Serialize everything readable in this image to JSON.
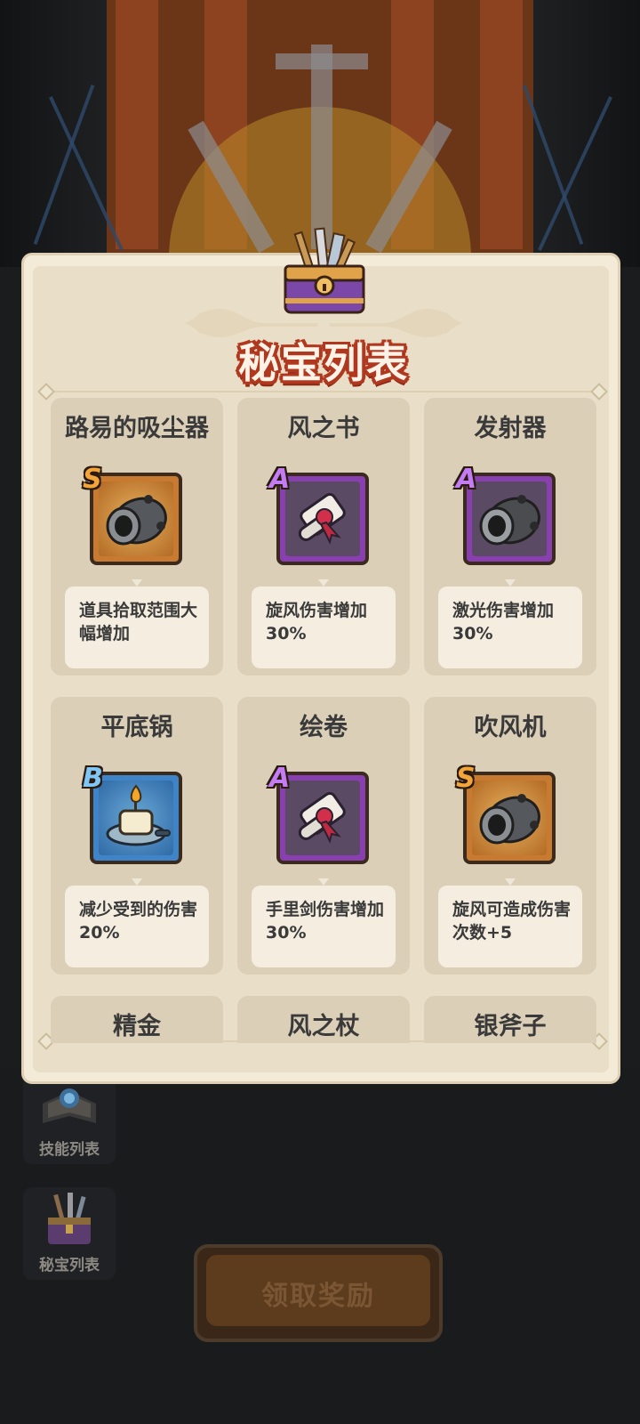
{
  "panel": {
    "title": "秘宝列表",
    "title_color": "#fff3e8",
    "title_outline_color": "#b0381e",
    "header_icon": "treasure-chest-icon"
  },
  "items": [
    {
      "name": "路易的吸尘器",
      "grade": "S",
      "icon": "cannon-icon",
      "desc": "道具拾取范围大幅增加"
    },
    {
      "name": "风之书",
      "grade": "A",
      "icon": "scroll-icon",
      "desc": "旋风伤害增加30%"
    },
    {
      "name": "发射器",
      "grade": "A",
      "icon": "cannon-icon",
      "desc": "激光伤害增加30%"
    },
    {
      "name": "平底锅",
      "grade": "B",
      "icon": "candle-pan-icon",
      "desc": "减少受到的伤害20%"
    },
    {
      "name": "绘卷",
      "grade": "A",
      "icon": "scroll-icon",
      "desc": "手里剑伤害增加30%"
    },
    {
      "name": "吹风机",
      "grade": "S",
      "icon": "cannon-icon",
      "desc": "旋风可造成伤害次数+5"
    },
    {
      "name": "精金",
      "grade": "",
      "icon": "",
      "desc": ""
    },
    {
      "name": "风之杖",
      "grade": "",
      "icon": "",
      "desc": ""
    },
    {
      "name": "银斧子",
      "grade": "",
      "icon": "",
      "desc": ""
    }
  ],
  "grade_colors": {
    "S": "#c77a30",
    "A": "#8a3fb1",
    "B": "#3f84c9"
  },
  "side_buttons": [
    {
      "label": "技能列表",
      "icon": "skill-book-icon"
    },
    {
      "label": "秘宝列表",
      "icon": "treasure-chest-icon"
    }
  ],
  "claim_button": {
    "label": "领取奖励"
  }
}
